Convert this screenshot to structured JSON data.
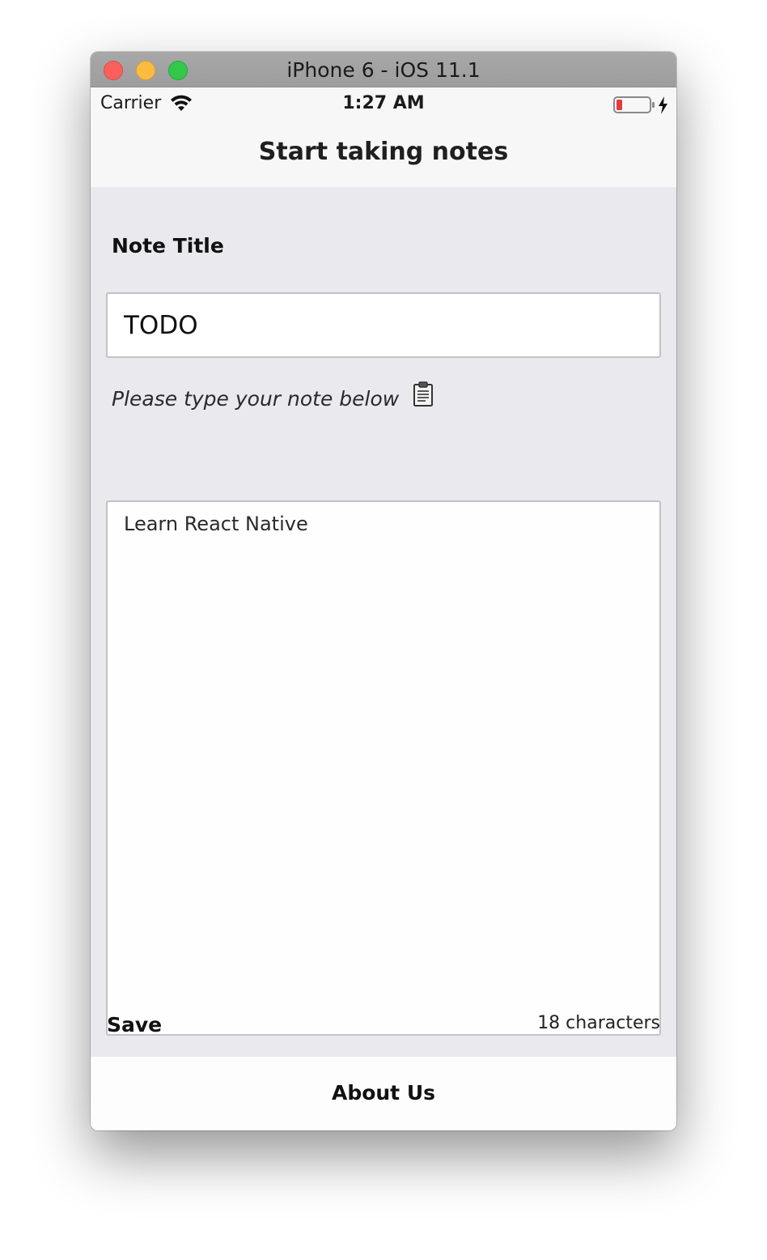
{
  "window": {
    "title": "iPhone 6 - iOS 11.1",
    "controls": [
      "close",
      "minimize",
      "zoom"
    ]
  },
  "status_bar": {
    "carrier": "Carrier",
    "time": "1:27 AM",
    "wifi_icon": "wifi-icon",
    "battery_icon": "battery-low-charging-icon",
    "battery_color": "#e8383b"
  },
  "nav": {
    "title": "Start taking notes"
  },
  "form": {
    "title_label": "Note Title",
    "title_value": "TODO",
    "note_hint": "Please type your note below",
    "note_hint_icon": "clipboard-icon",
    "note_value": "Learn React Native",
    "save_label": "Save",
    "char_count": "18 characters"
  },
  "tab": {
    "about_label": "About Us"
  }
}
